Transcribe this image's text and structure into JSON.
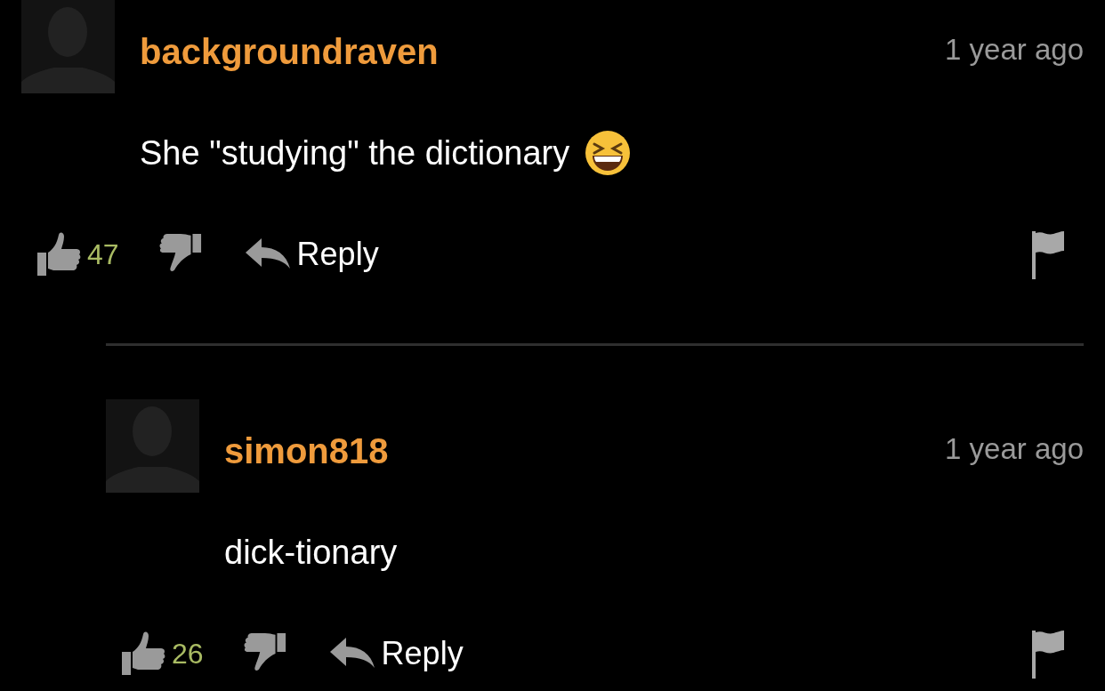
{
  "comments": [
    {
      "username": "backgroundraven",
      "time": "1 year ago",
      "text": "She \"studying\" the dictionary",
      "emoji": true,
      "likes": "47",
      "reply_label": "Reply",
      "replies": [
        {
          "username": "simon818",
          "time": "1 year ago",
          "text": "dick-tionary",
          "likes": "26",
          "reply_label": "Reply"
        }
      ]
    }
  ]
}
